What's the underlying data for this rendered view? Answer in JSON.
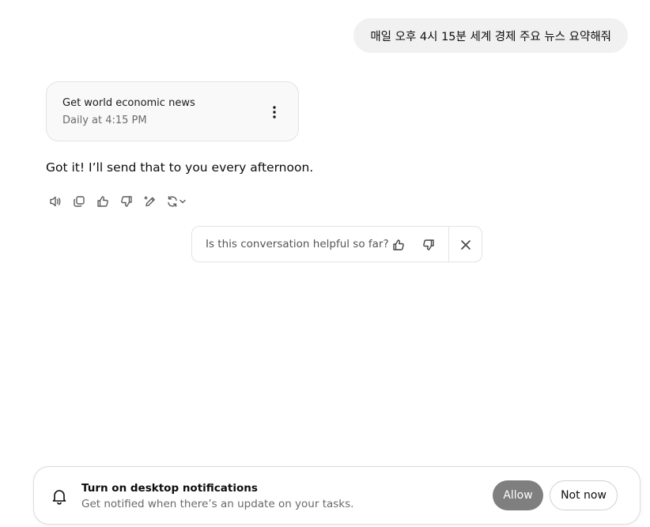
{
  "user_message": {
    "text": "매일 오후 4시 15분 세계 경제 주요 뉴스 요약해줘"
  },
  "task_card": {
    "title": "Get world economic news",
    "schedule": "Daily at 4:15 PM",
    "menu_icon": "vertical-ellipsis-icon"
  },
  "assistant_message": {
    "text": "Got it! I’ll send that to you every afternoon."
  },
  "message_actions": [
    {
      "name": "read-aloud",
      "icon": "speaker-icon"
    },
    {
      "name": "copy",
      "icon": "copy-icon"
    },
    {
      "name": "good-response",
      "icon": "thumbs-up-icon"
    },
    {
      "name": "bad-response",
      "icon": "thumbs-down-icon"
    },
    {
      "name": "edit-in-canvas",
      "icon": "pen-sparkle-icon"
    },
    {
      "name": "regenerate",
      "icon": "refresh-icon"
    }
  ],
  "feedback": {
    "question": "Is this conversation helpful so far?",
    "icons": [
      "thumbs-up-icon",
      "thumbs-down-icon",
      "close-icon"
    ]
  },
  "notification": {
    "title": "Turn on desktop notifications",
    "subtitle": "Get notified when there’s an update on your tasks.",
    "allow_label": "Allow",
    "not_now_label": "Not now",
    "icon": "bell-icon"
  },
  "colors": {
    "user_bubble_bg": "#f1f1f1",
    "card_bg": "#f9f9f9",
    "allow_bg": "#7f7f7f",
    "border": "#e3e3e3"
  }
}
